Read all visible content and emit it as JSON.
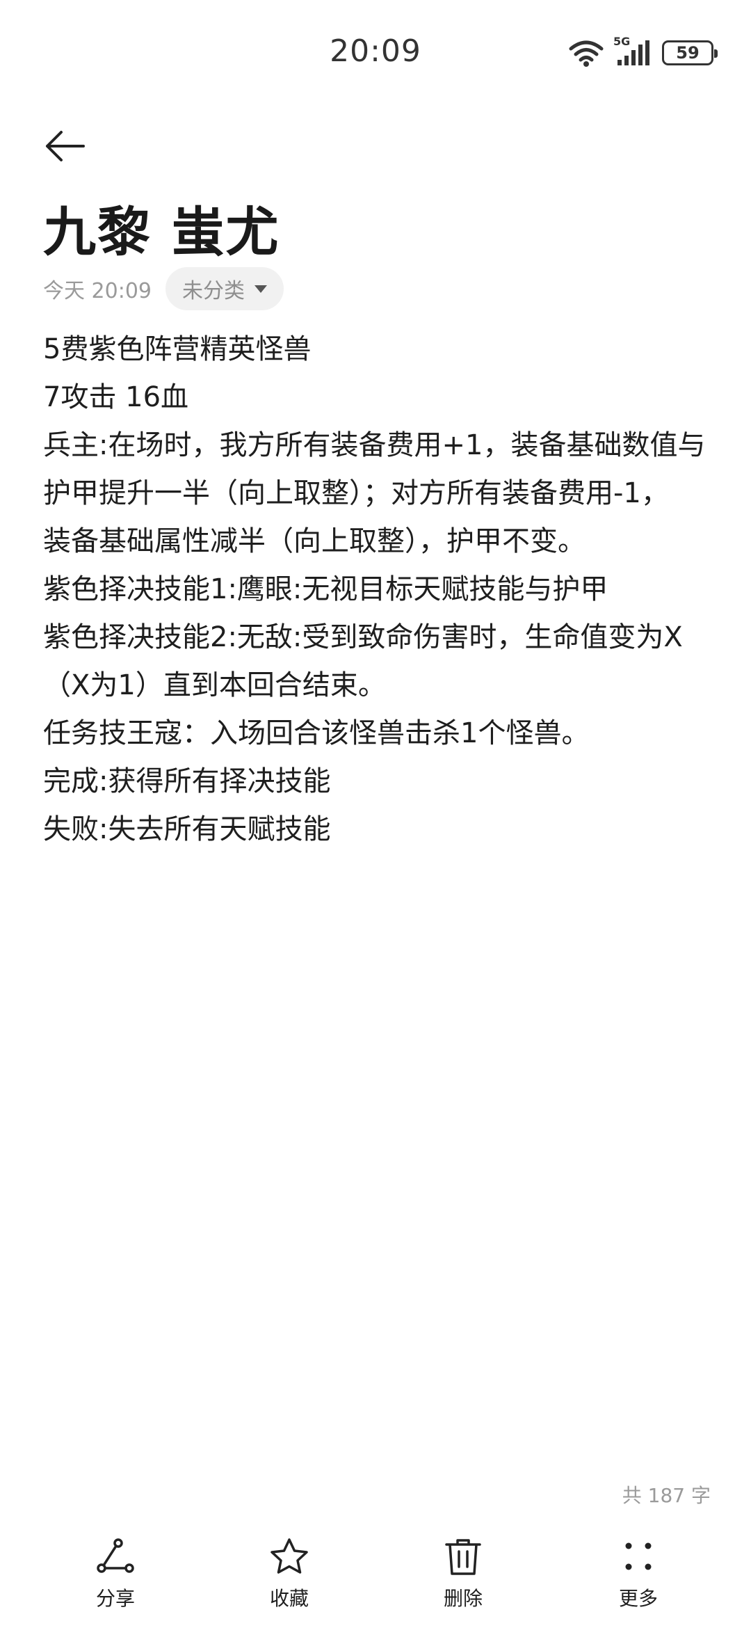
{
  "status": {
    "time": "20:09",
    "network": "5G",
    "battery": "59"
  },
  "note": {
    "title": "九黎 蚩尤",
    "date": "今天 20:09",
    "category": "未分类",
    "lines": [
      "5费紫色阵营精英怪兽",
      "7攻击 16血",
      "兵主:在场时，我方所有装备费用+1，装备基础数值与",
      "护甲提升一半（向上取整）；对方所有装备费用-1，",
      "装备基础属性减半（向上取整），护甲不变。",
      "紫色择决技能1:鹰眼:无视目标天赋技能与护甲",
      "紫色择决技能2:无敌:受到致命伤害时，生命值变为X",
      "（X为1）直到本回合结束。",
      "任务技王寇：入场回合该怪兽击杀1个怪兽。",
      "完成:获得所有择决技能",
      "失败:失去所有天赋技能"
    ],
    "word_count": "共 187 字"
  },
  "toolbar": {
    "share": "分享",
    "favorite": "收藏",
    "delete": "删除",
    "more": "更多"
  }
}
